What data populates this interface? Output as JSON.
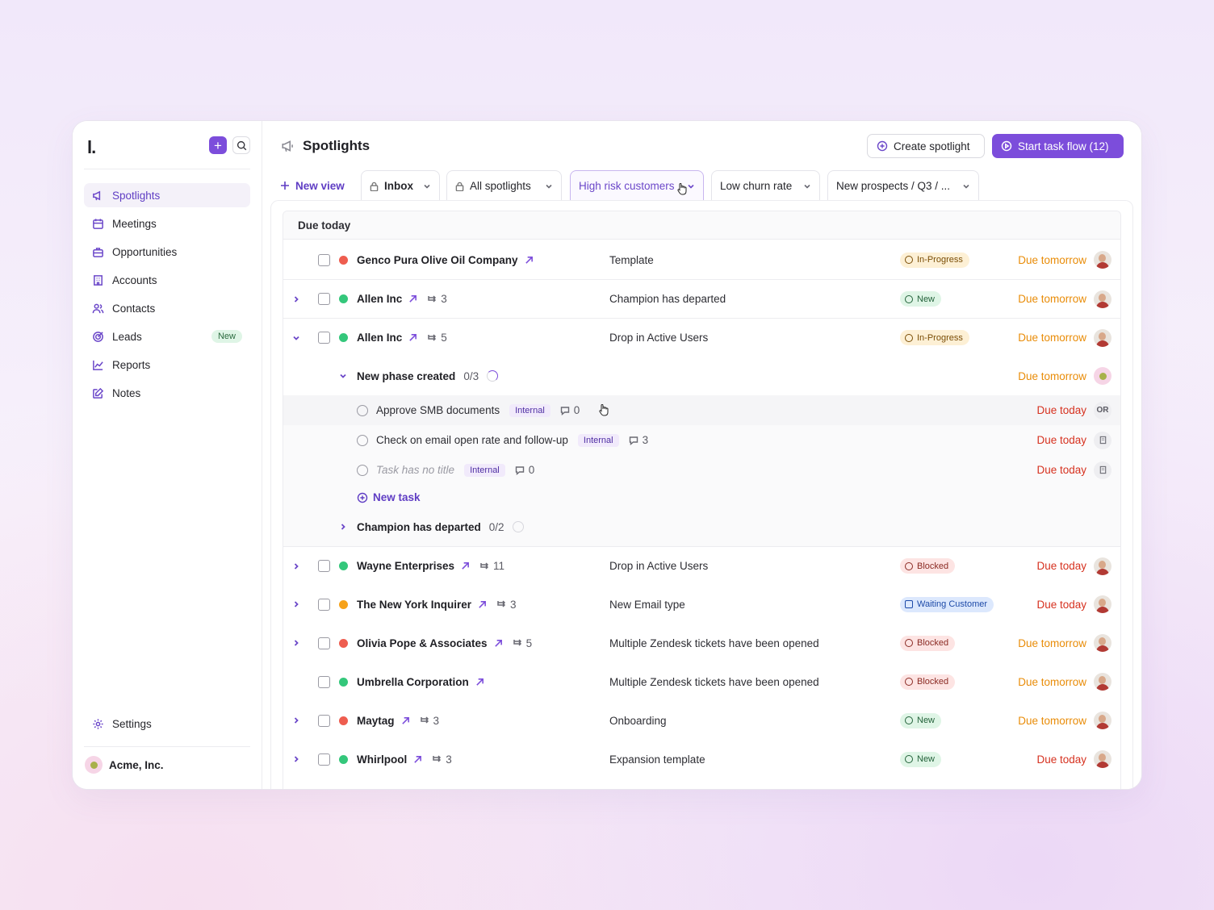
{
  "app": {
    "logo": "l.",
    "org_name": "Acme, Inc."
  },
  "sidebar": {
    "items": [
      {
        "label": "Spotlights",
        "icon": "megaphone-icon",
        "active": true
      },
      {
        "label": "Meetings",
        "icon": "calendar-icon"
      },
      {
        "label": "Opportunities",
        "icon": "briefcase-icon"
      },
      {
        "label": "Accounts",
        "icon": "building-icon"
      },
      {
        "label": "Contacts",
        "icon": "users-icon"
      },
      {
        "label": "Leads",
        "icon": "target-icon",
        "badge": "New"
      },
      {
        "label": "Reports",
        "icon": "chart-icon"
      },
      {
        "label": "Notes",
        "icon": "edit-icon"
      }
    ],
    "settings_label": "Settings"
  },
  "header": {
    "title": "Spotlights",
    "create_label": "Create spotlight",
    "start_label": "Start task flow (12)"
  },
  "tabs": {
    "new_view": "New view",
    "items": [
      "Inbox",
      "All spotlights",
      "High risk customers",
      "Low churn rate",
      "New prospects / Q3 / ..."
    ],
    "selected": "High risk customers"
  },
  "section": {
    "title": "Due today"
  },
  "rows": [
    {
      "name": "Genco Pura Olive Oil Company",
      "status_color": "#ee5d4f",
      "sub_count": "",
      "reason": "Template",
      "pill": "In-Progress",
      "due": "Due tomorrow"
    },
    {
      "name": "Allen Inc",
      "status_color": "#34c77b",
      "sub_count": "3",
      "reason": "Champion has departed",
      "pill": "New",
      "due": "Due tomorrow"
    },
    {
      "name": "Allen Inc",
      "status_color": "#34c77b",
      "sub_count": "5",
      "reason": "Drop in Active Users",
      "pill": "In-Progress",
      "due": "Due tomorrow"
    },
    {
      "name": "Wayne Enterprises",
      "status_color": "#34c77b",
      "sub_count": "11",
      "reason": "Drop in Active Users",
      "pill": "Blocked",
      "due": "Due today"
    },
    {
      "name": "The New York Inquirer",
      "status_color": "#f6a21a",
      "sub_count": "3",
      "reason": "New Email type",
      "pill": "Waiting Customer",
      "due": "Due today"
    },
    {
      "name": "Olivia Pope & Associates",
      "status_color": "#ee5d4f",
      "sub_count": "5",
      "reason": "Multiple Zendesk tickets have been opened",
      "pill": "Blocked",
      "due": "Due tomorrow"
    },
    {
      "name": "Umbrella Corporation",
      "status_color": "#34c77b",
      "sub_count": "",
      "reason": "Multiple Zendesk tickets have been opened",
      "pill": "Blocked",
      "due": "Due tomorrow"
    },
    {
      "name": "Maytag",
      "status_color": "#ee5d4f",
      "sub_count": "3",
      "reason": "Onboarding",
      "pill": "New",
      "due": "Due tomorrow"
    },
    {
      "name": "Whirlpool",
      "status_color": "#34c77b",
      "sub_count": "3",
      "reason": "Expansion template",
      "pill": "New",
      "due": "Due today"
    }
  ],
  "phases": [
    {
      "name": "New phase created",
      "count": "0/3",
      "due": "Due tomorrow"
    },
    {
      "name": "Champion has departed",
      "count": "0/2"
    }
  ],
  "tasks": [
    {
      "title": "Approve SMB documents",
      "tag": "Internal",
      "comments": "0",
      "due": "Due today",
      "assignee": "OR"
    },
    {
      "title": "Check on email open rate and follow-up",
      "tag": "Internal",
      "comments": "3",
      "due": "Due today"
    },
    {
      "title": "Task has no title",
      "tag": "Internal",
      "comments": "0",
      "due": "Due today"
    }
  ],
  "new_task_label": "New task",
  "colors": {
    "accent": "#7c4ddb",
    "due_tomorrow": "#e98c08",
    "due_today": "#d6311f"
  }
}
